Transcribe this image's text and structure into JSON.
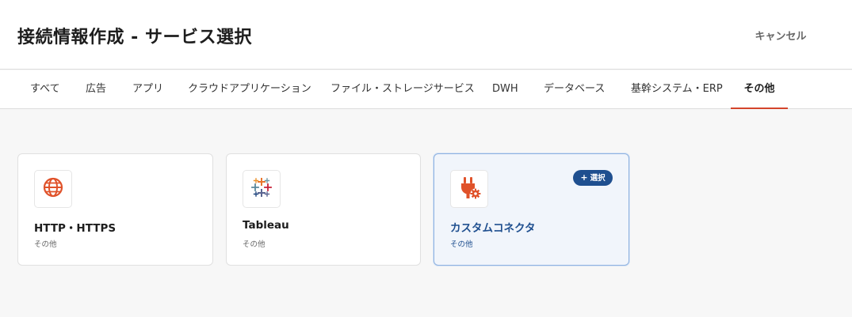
{
  "header": {
    "title": "接続情報作成 - サービス選択",
    "cancel_label": "キャンセル"
  },
  "tabs": [
    {
      "label": "すべて",
      "active": false
    },
    {
      "label": "広告",
      "active": false
    },
    {
      "label": "アプリ",
      "active": false
    },
    {
      "label": "クラウドアプリケーション",
      "active": false
    },
    {
      "label": "ファイル・ストレージサービス",
      "active": false
    },
    {
      "label": "DWH",
      "active": false
    },
    {
      "label": "データベース",
      "active": false
    },
    {
      "label": "基幹システム・ERP",
      "active": false
    },
    {
      "label": "その他",
      "active": true
    }
  ],
  "cards": [
    {
      "name": "HTTP・HTTPS",
      "category": "その他",
      "icon": "globe-icon",
      "selected": false
    },
    {
      "name": "Tableau",
      "category": "その他",
      "icon": "tableau-logo-icon",
      "selected": false
    },
    {
      "name": "カスタムコネクタ",
      "category": "その他",
      "icon": "plug-gear-icon",
      "selected": true,
      "badge": "選択",
      "badge_icon": "plus-icon"
    }
  ],
  "colors": {
    "accent": "#d4452b",
    "primary": "#1f4f8f",
    "icon_orange": "#e0522a"
  }
}
